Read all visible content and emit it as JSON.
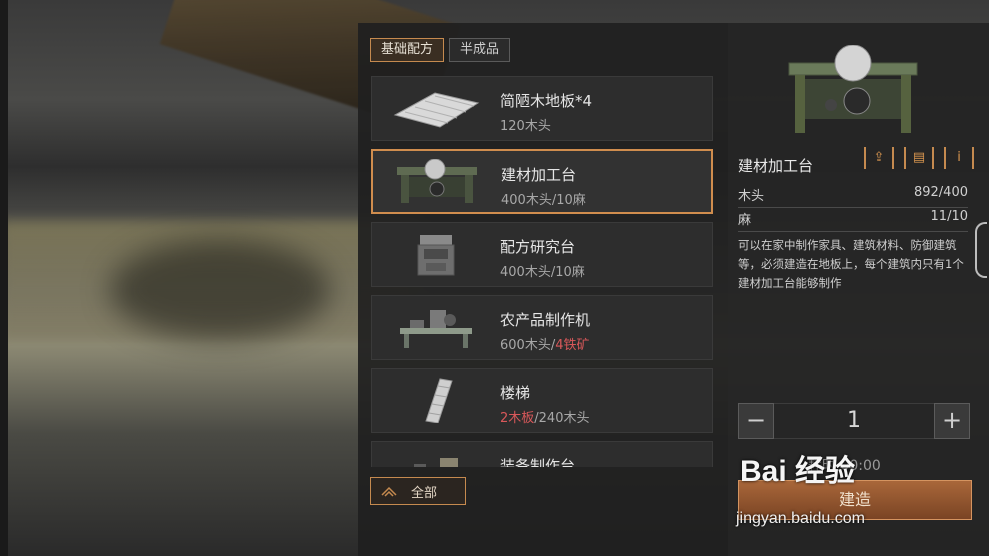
{
  "tabs": [
    {
      "label": "基础配方",
      "active": true
    },
    {
      "label": "半成品",
      "active": false
    }
  ],
  "recipes": [
    {
      "name": "简陋木地板*4",
      "cost": [
        {
          "text": "120木头",
          "insufficient": false
        }
      ],
      "icon": "wood-floor-icon"
    },
    {
      "name": "建材加工台",
      "cost": [
        {
          "text": "400木头/10麻",
          "insufficient": false
        }
      ],
      "icon": "saw-bench-icon",
      "selected": true
    },
    {
      "name": "配方研究台",
      "cost": [
        {
          "text": "400木头/10麻",
          "insufficient": false
        }
      ],
      "icon": "research-desk-icon"
    },
    {
      "name": "农产品制作机",
      "cost": [
        {
          "text": "600木头/",
          "insufficient": false
        },
        {
          "text": "4铁矿",
          "insufficient": true
        }
      ],
      "icon": "farm-machine-icon"
    },
    {
      "name": "楼梯",
      "cost": [
        {
          "text": "2木板",
          "insufficient": true
        },
        {
          "text": "/240木头",
          "insufficient": false
        }
      ],
      "icon": "stairs-icon"
    },
    {
      "name": "装备制作台",
      "cost": [],
      "icon": "equipment-bench-icon"
    }
  ],
  "filter_button": {
    "label": "全部"
  },
  "detail": {
    "title": "建材加工台",
    "requirements": [
      {
        "name": "木头",
        "amount": "892/400"
      },
      {
        "name": "麻",
        "amount": "11/10"
      }
    ],
    "description": "可以在家中制作家具、建筑材料、防御建筑等，必须建造在地板上，每个建筑内只有1个建材加工台能够制作",
    "quantity": "1",
    "time": "耗时 00:00",
    "build_label": "建造"
  },
  "watermark": {
    "logo": "Bai 经验",
    "url": "jingyan.baidu.com"
  },
  "colors": {
    "accent": "#c58a4f",
    "insufficient": "#d9585a"
  }
}
